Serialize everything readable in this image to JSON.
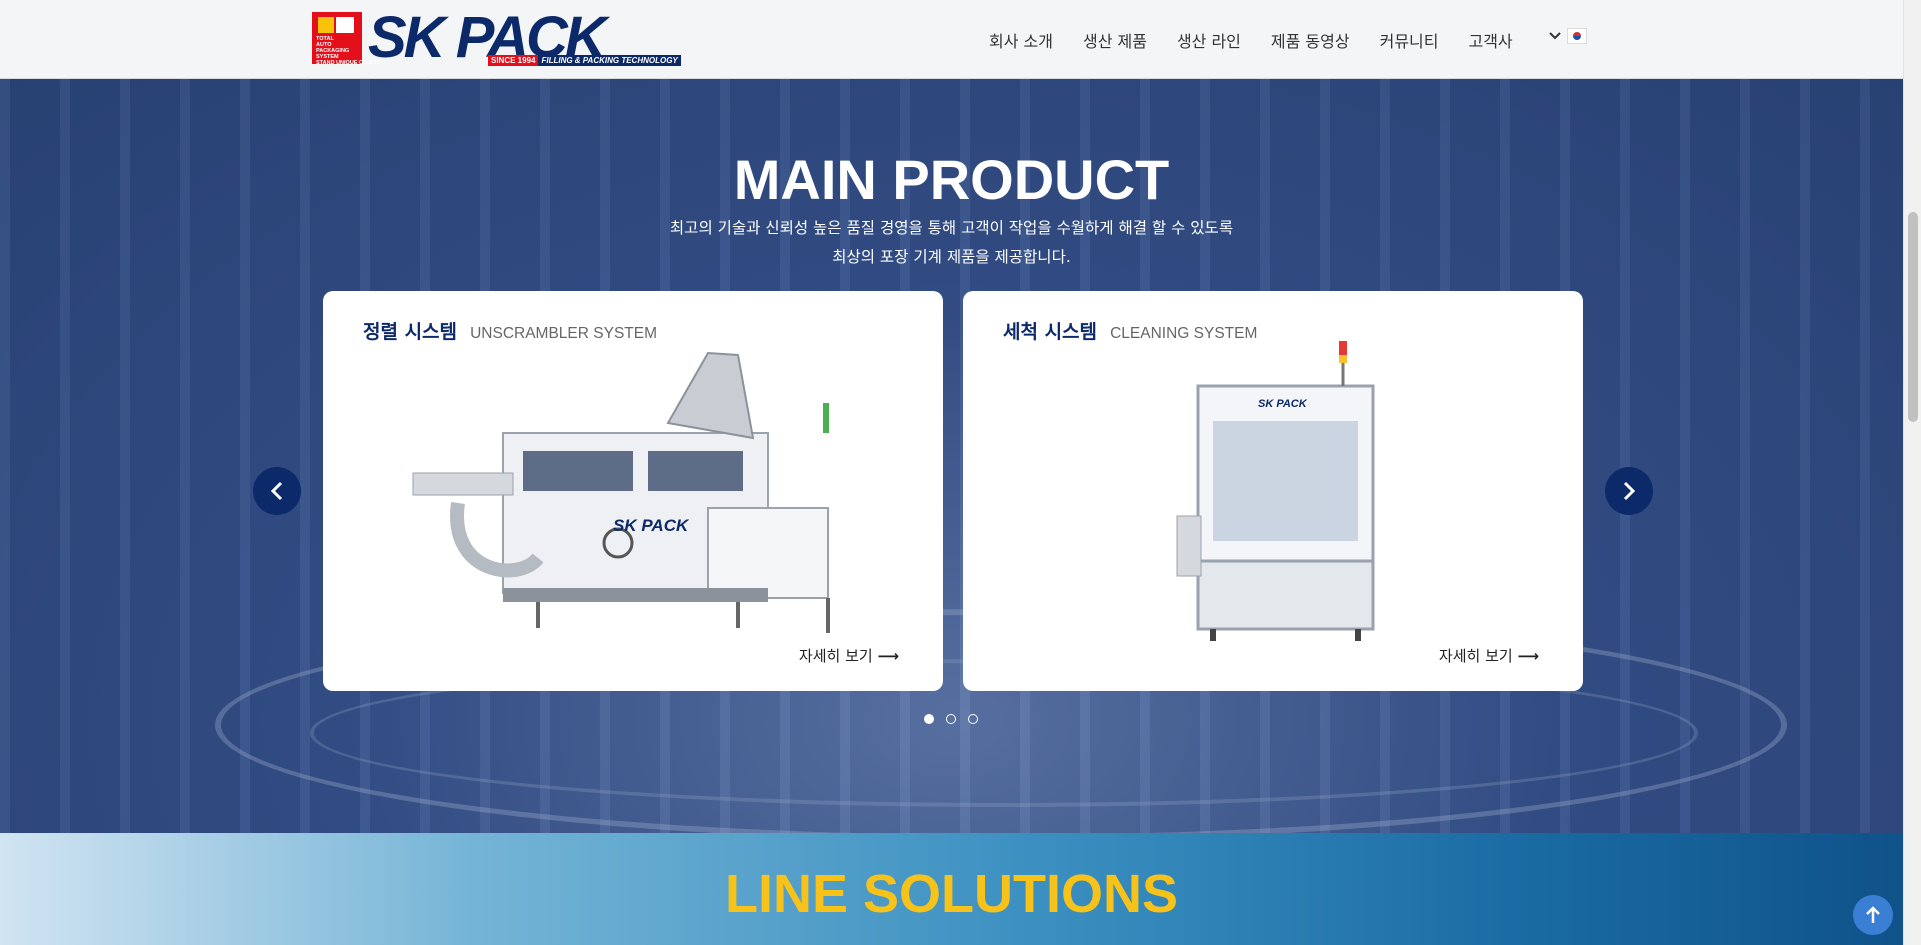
{
  "header": {
    "logo": {
      "mark_text": "TOTAL\nAUTO\nPACKAGING\nSYSTEM\nSTAND UNIQUE CO.,LTD",
      "brand_sk": "SK",
      "brand_pack": "PACK",
      "since": "SINCE 1994",
      "tagline": "FILLING & PACKING TECHNOLOGY"
    },
    "nav": [
      "회사 소개",
      "생산 제품",
      "생산 라인",
      "제품 동영상",
      "커뮤니티",
      "고객사"
    ],
    "lang_icon": "chevron-down-icon"
  },
  "hero": {
    "title": "MAIN PRODUCT",
    "subtitle_line1": "최고의 기술과 신뢰성 높은 품질 경영을 통해 고객이 작업을 수월하게 해결 할 수 있도록",
    "subtitle_line2": "최상의 포장 기계 제품을 제공합니다.",
    "cards": [
      {
        "title_kr": "정렬 시스템",
        "title_en": "UNSCRAMBLER SYSTEM",
        "more": "자세히 보기"
      },
      {
        "title_kr": "세척 시스템",
        "title_en": "CLEANING SYSTEM",
        "more": "자세히 보기"
      }
    ],
    "machine_label_left": "SK PACK",
    "machine_label_right": "SK PACK",
    "slider": {
      "active_index": 0,
      "dot_count": 3
    }
  },
  "lines": {
    "title": "LINE SOLUTIONS"
  },
  "colors": {
    "navy": "#0c2a6a",
    "red": "#e3101c",
    "yellow": "#f7c21a"
  }
}
